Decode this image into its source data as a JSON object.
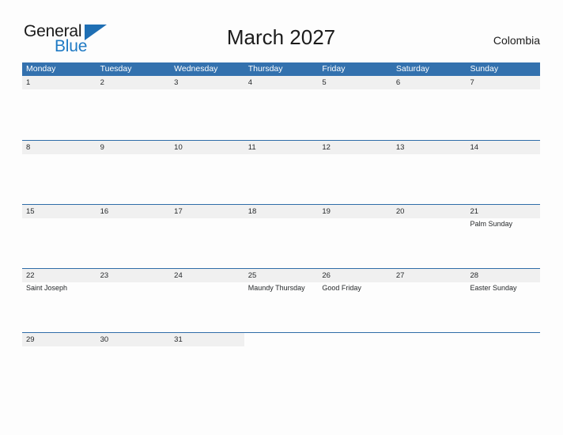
{
  "logo": {
    "word_top": "General",
    "word_bottom": "Blue",
    "accent_color": "#1f6fb4"
  },
  "header": {
    "title": "March 2027",
    "country": "Colombia"
  },
  "colors": {
    "header_blue": "#3371ae",
    "row_rule_blue": "#2f6da8",
    "day_band_gray": "#f0f0f0",
    "page_background": "#fdfdfd",
    "text": "#26292b"
  },
  "calendar": {
    "weekdays": [
      "Monday",
      "Tuesday",
      "Wednesday",
      "Thursday",
      "Friday",
      "Saturday",
      "Sunday"
    ],
    "weeks": [
      [
        {
          "date": "1",
          "events": []
        },
        {
          "date": "2",
          "events": []
        },
        {
          "date": "3",
          "events": []
        },
        {
          "date": "4",
          "events": []
        },
        {
          "date": "5",
          "events": []
        },
        {
          "date": "6",
          "events": []
        },
        {
          "date": "7",
          "events": []
        }
      ],
      [
        {
          "date": "8",
          "events": []
        },
        {
          "date": "9",
          "events": []
        },
        {
          "date": "10",
          "events": []
        },
        {
          "date": "11",
          "events": []
        },
        {
          "date": "12",
          "events": []
        },
        {
          "date": "13",
          "events": []
        },
        {
          "date": "14",
          "events": []
        }
      ],
      [
        {
          "date": "15",
          "events": []
        },
        {
          "date": "16",
          "events": []
        },
        {
          "date": "17",
          "events": []
        },
        {
          "date": "18",
          "events": []
        },
        {
          "date": "19",
          "events": []
        },
        {
          "date": "20",
          "events": []
        },
        {
          "date": "21",
          "events": [
            "Palm Sunday"
          ]
        }
      ],
      [
        {
          "date": "22",
          "events": [
            "Saint Joseph"
          ]
        },
        {
          "date": "23",
          "events": []
        },
        {
          "date": "24",
          "events": []
        },
        {
          "date": "25",
          "events": [
            "Maundy Thursday"
          ]
        },
        {
          "date": "26",
          "events": [
            "Good Friday"
          ]
        },
        {
          "date": "27",
          "events": []
        },
        {
          "date": "28",
          "events": [
            "Easter Sunday"
          ]
        }
      ],
      [
        {
          "date": "29",
          "events": []
        },
        {
          "date": "30",
          "events": []
        },
        {
          "date": "31",
          "events": []
        },
        {
          "date": "",
          "events": []
        },
        {
          "date": "",
          "events": []
        },
        {
          "date": "",
          "events": []
        },
        {
          "date": "",
          "events": []
        }
      ]
    ]
  }
}
